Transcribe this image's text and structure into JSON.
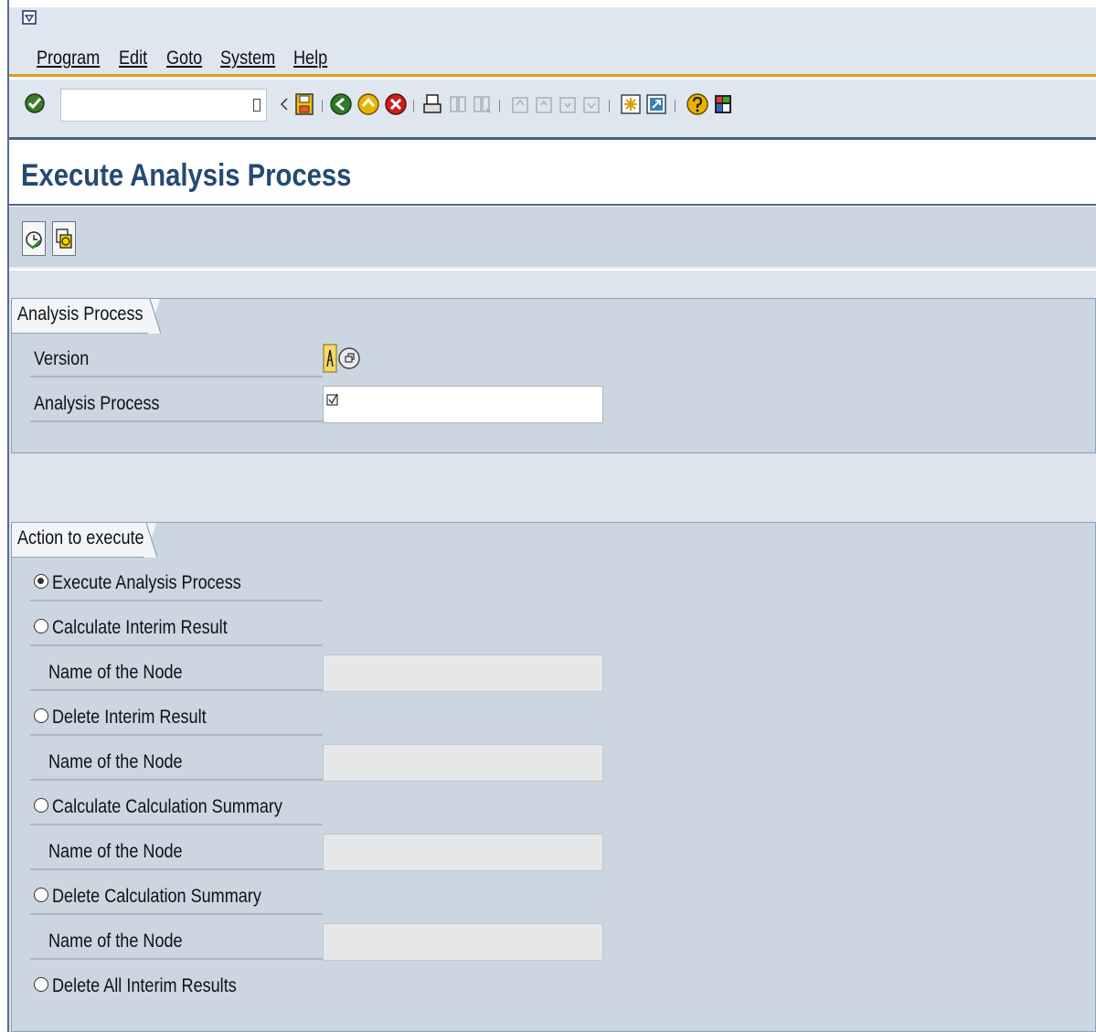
{
  "menu": {
    "items": [
      "Program",
      "Edit",
      "Goto",
      "System",
      "Help"
    ]
  },
  "toolbar": {
    "command_field_value": ""
  },
  "page": {
    "title": "Execute Analysis Process"
  },
  "analysis_group": {
    "title": "Analysis Process",
    "version_label": "Version",
    "process_label": "Analysis Process",
    "process_value": ""
  },
  "action_group": {
    "title": "Action to execute",
    "options": [
      {
        "label": "Execute Analysis Process",
        "selected": true
      },
      {
        "label": "Calculate Interim Result",
        "selected": false
      },
      {
        "label": "Delete Interim Result",
        "selected": false
      },
      {
        "label": "Calculate Calculation Summary",
        "selected": false
      },
      {
        "label": "Delete Calculation Summary",
        "selected": false
      },
      {
        "label": "Delete All Interim Results",
        "selected": false
      }
    ],
    "node_label": "Name of the Node",
    "node_labels": [
      "Name of the Node",
      "Name of the Node",
      "Name of the Node",
      "Name of the Node"
    ]
  },
  "colors": {
    "accent_orange": "#e59a1c",
    "title_blue": "#244a74",
    "panel_bg": "#cbd6e1"
  }
}
